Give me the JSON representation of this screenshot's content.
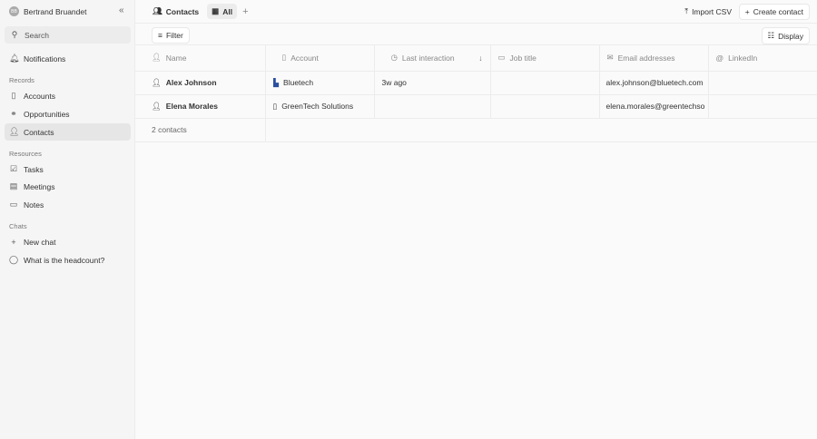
{
  "sidebar": {
    "user": {
      "initials": "BB",
      "name": "Bertrand Bruandet"
    },
    "search": "Search",
    "notifications": "Notifications",
    "records_label": "Records",
    "records": [
      "Accounts",
      "Opportunities",
      "Contacts"
    ],
    "resources_label": "Resources",
    "resources": [
      "Tasks",
      "Meetings",
      "Notes"
    ],
    "chats_label": "Chats",
    "new_chat": "New chat",
    "chats": [
      "What is the headcount?"
    ]
  },
  "topbar": {
    "title": "Contacts",
    "view": "All",
    "import": "Import CSV",
    "create": "Create contact"
  },
  "toolbar": {
    "filter": "Filter",
    "display": "Display"
  },
  "table": {
    "columns": [
      "Name",
      "Account",
      "Last interaction",
      "Job title",
      "Email addresses",
      "LinkedIn"
    ],
    "rows": [
      {
        "name": "Alex Johnson",
        "account": "Bluetech",
        "last": "3w ago",
        "job": "",
        "email": "alex.johnson@bluetech.com",
        "linkedin": ""
      },
      {
        "name": "Elena Morales",
        "account": "GreenTech Solutions",
        "last": "",
        "job": "",
        "email": "elena.morales@greentechso",
        "linkedin": ""
      }
    ],
    "footer": "2 contacts"
  }
}
